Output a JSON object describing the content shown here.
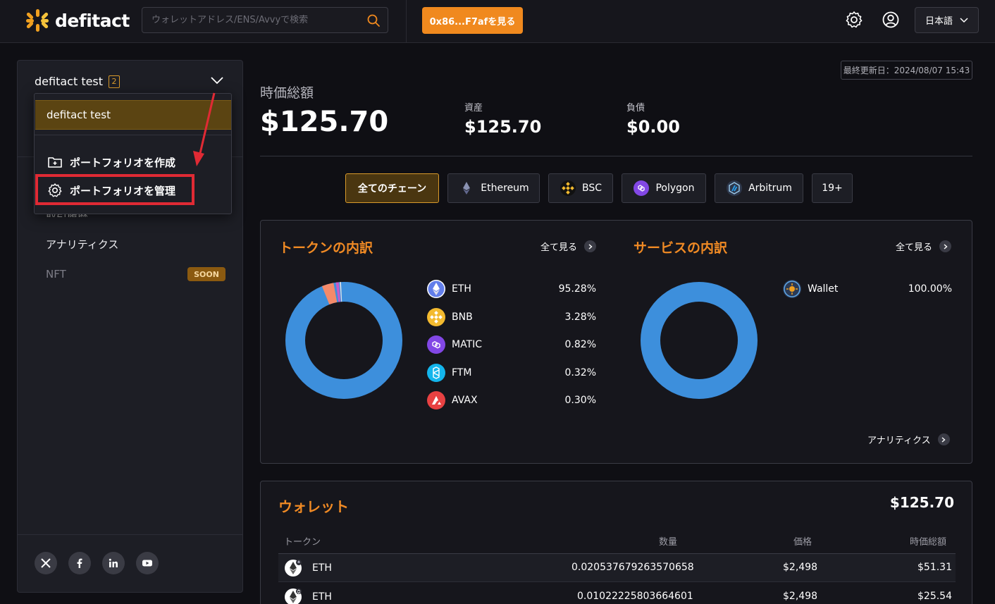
{
  "header": {
    "brand": "defitact",
    "search_placeholder": "ウォレットアドレス/ENS/Avvyで検索",
    "address_button": "0x86...F7afを見る",
    "language": "日本語"
  },
  "sidebar": {
    "portfolio_name": "defitact test",
    "portfolio_count": "2",
    "partial_item": "取引履歴",
    "analytics": "アナリティクス",
    "nft": "NFT",
    "soon": "SOON"
  },
  "dropdown": {
    "selected": "defitact test",
    "create": "ポートフォリオを作成",
    "manage": "ポートフォリオを管理"
  },
  "summary": {
    "updated": "最終更新日：2024/08/07 15:43",
    "total_label": "時価総額",
    "total_value": "$125.70",
    "assets_label": "資産",
    "assets_value": "$125.70",
    "debt_label": "負債",
    "debt_value": "$0.00"
  },
  "chains": {
    "all": "全てのチェーン",
    "ethereum": "Ethereum",
    "bsc": "BSC",
    "polygon": "Polygon",
    "arbitrum": "Arbitrum",
    "more": "19+"
  },
  "tokens": {
    "title": "トークンの内訳",
    "see_all": "全て見る",
    "items": [
      {
        "symbol": "ETH",
        "pct": "95.28%"
      },
      {
        "symbol": "BNB",
        "pct": "3.28%"
      },
      {
        "symbol": "MATIC",
        "pct": "0.82%"
      },
      {
        "symbol": "FTM",
        "pct": "0.32%"
      },
      {
        "symbol": "AVAX",
        "pct": "0.30%"
      }
    ]
  },
  "services": {
    "title": "サービスの内訳",
    "see_all": "全て見る",
    "items": [
      {
        "name": "Wallet",
        "pct": "100.00%"
      }
    ],
    "analytics_link": "アナリティクス"
  },
  "wallet": {
    "title": "ウォレット",
    "total": "$125.70",
    "headers": {
      "token": "トークン",
      "amount": "数量",
      "price": "価格",
      "value": "時価総額"
    },
    "rows": [
      {
        "token": "ETH",
        "amount": "0.020537679263570658",
        "price": "$2,498",
        "value": "$51.31"
      },
      {
        "token": "ETH",
        "amount": "0.01022225803664601",
        "price": "$2,498",
        "value": "$25.54"
      }
    ]
  },
  "colors": {
    "accent": "#f08a24",
    "eth_blue": "#3d8fdc",
    "highlight_red": "#e02a34"
  }
}
